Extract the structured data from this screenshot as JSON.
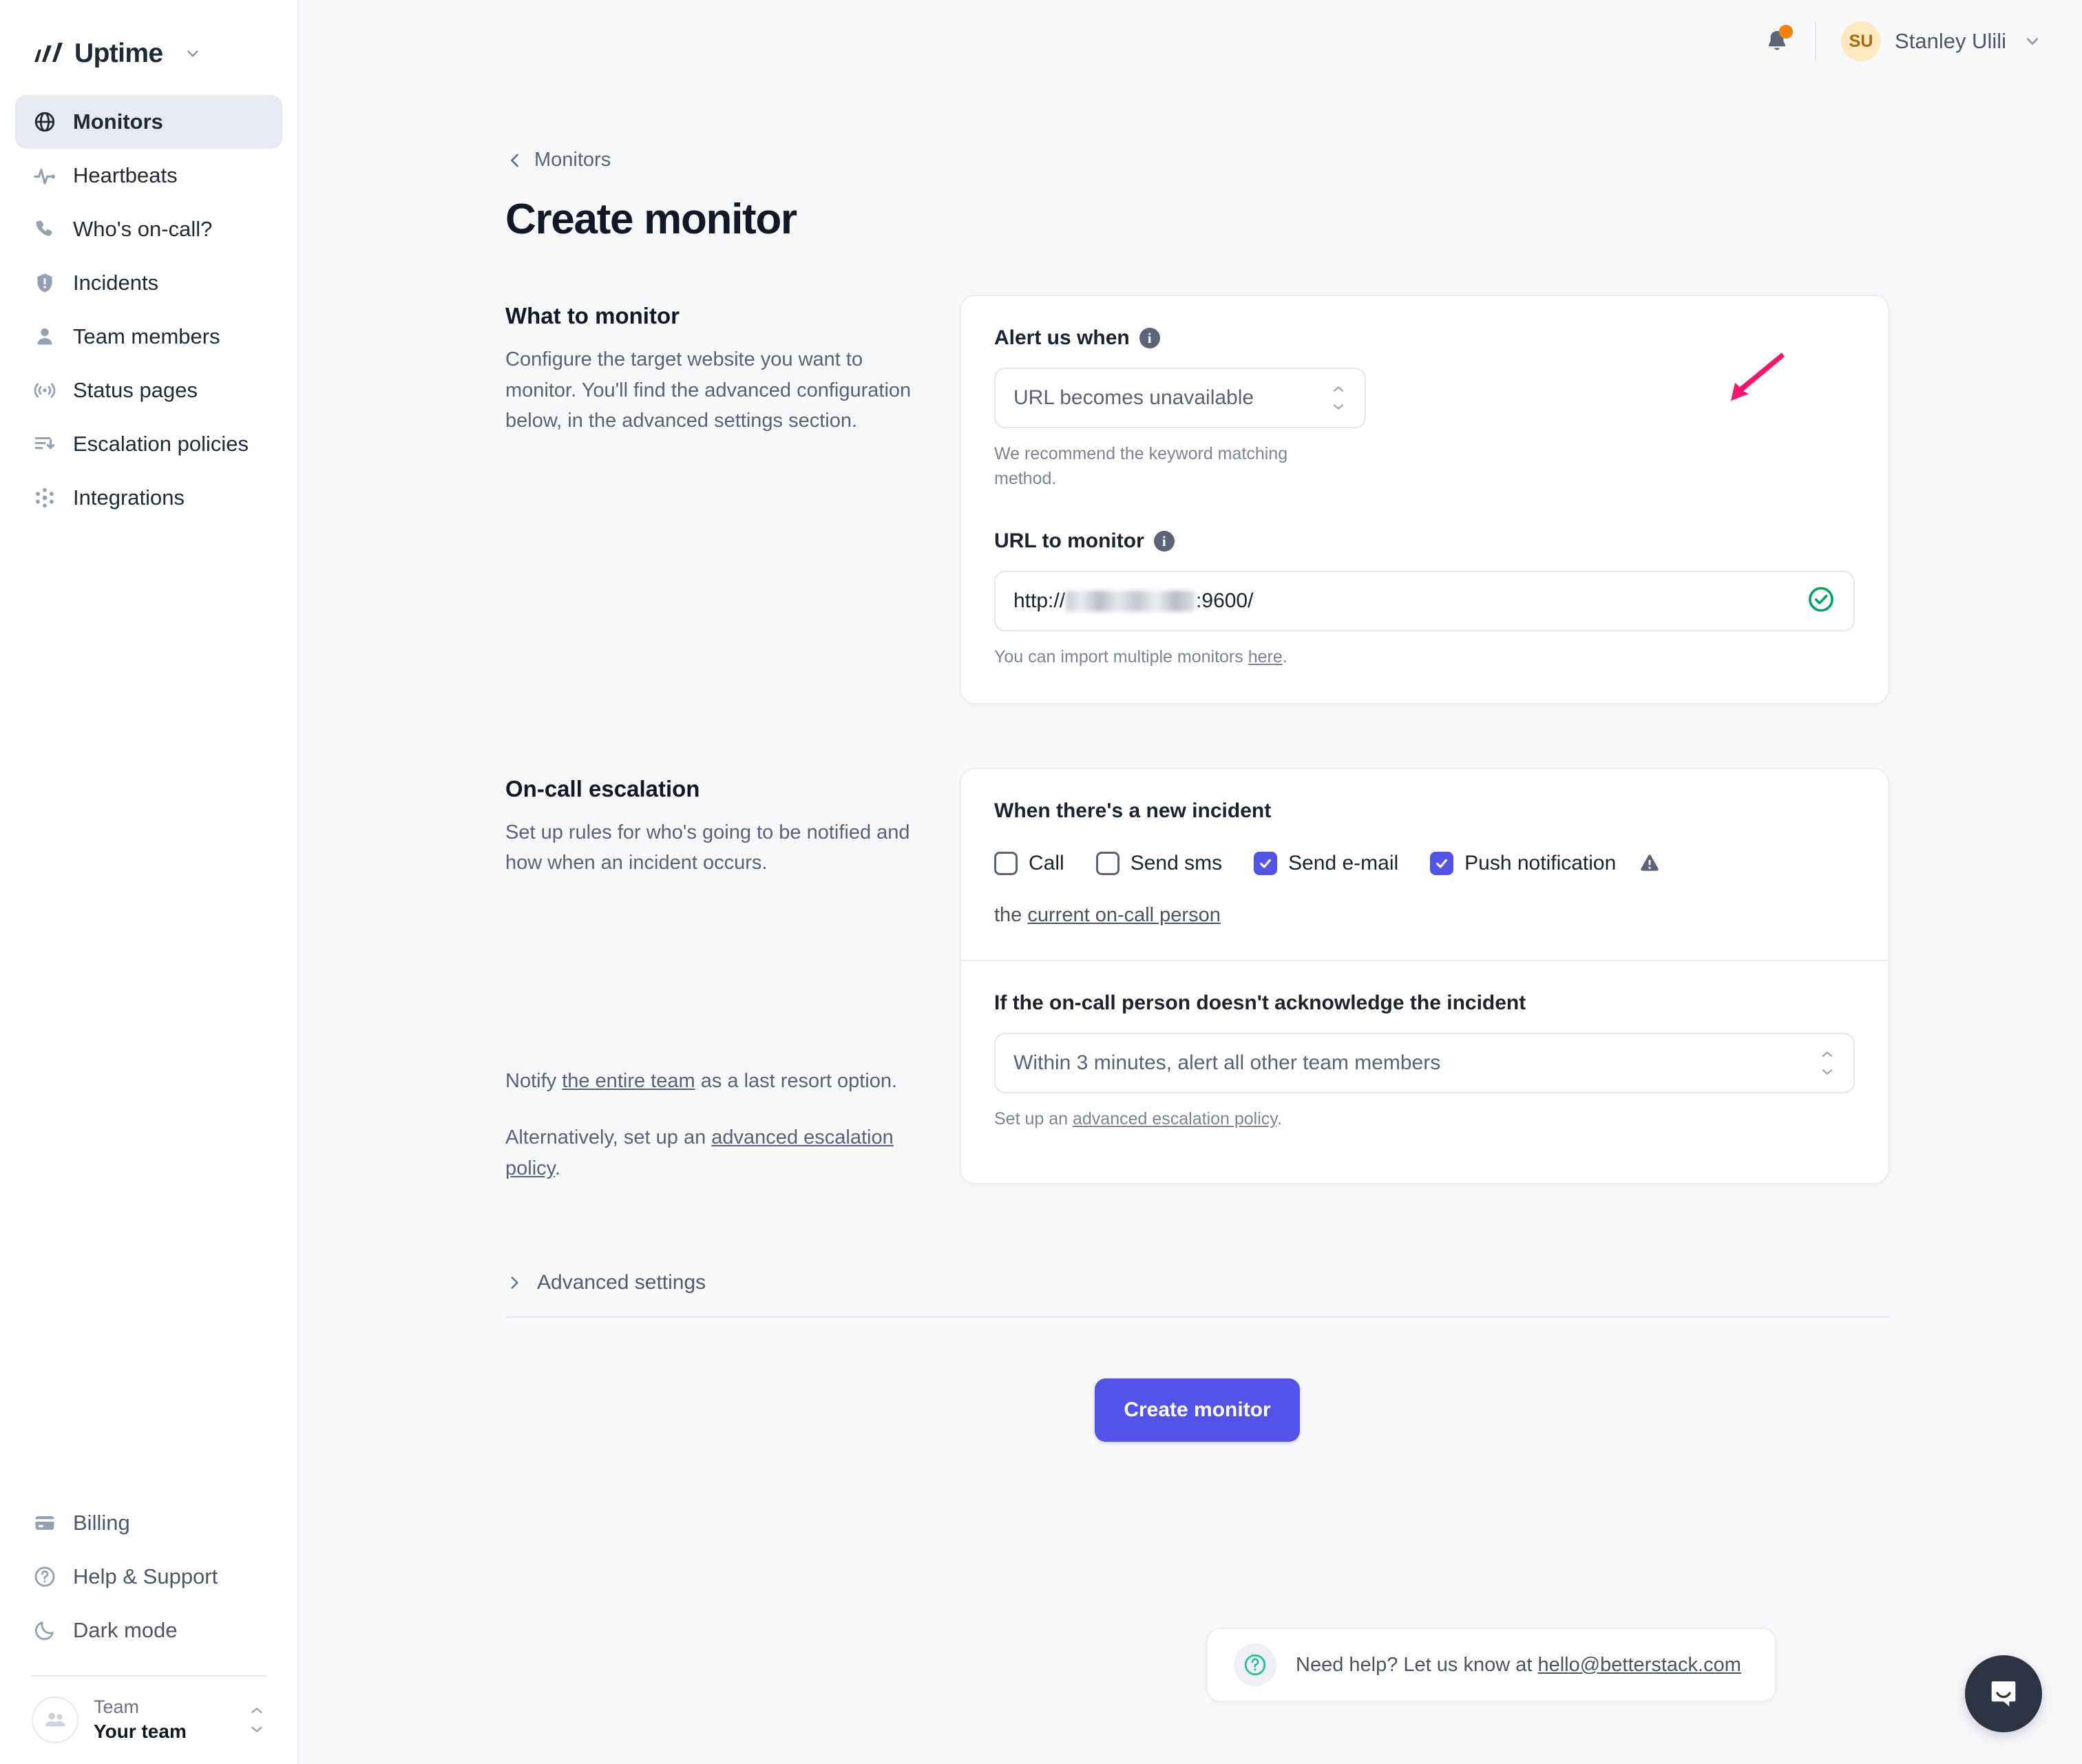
{
  "brand": {
    "name": "Uptime",
    "caret_icon": "chevron-down-icon",
    "logo_icon": "uptime-logo-icon"
  },
  "sidebar": {
    "items": [
      {
        "label": "Monitors",
        "icon": "globe-icon",
        "active": true
      },
      {
        "label": "Heartbeats",
        "icon": "pulse-icon",
        "active": false
      },
      {
        "label": "Who's on-call?",
        "icon": "phone-icon",
        "active": false
      },
      {
        "label": "Incidents",
        "icon": "shield-alert-icon",
        "active": false
      },
      {
        "label": "Team members",
        "icon": "user-icon",
        "active": false
      },
      {
        "label": "Status pages",
        "icon": "broadcast-icon",
        "active": false
      },
      {
        "label": "Escalation policies",
        "icon": "escalation-icon",
        "active": false
      },
      {
        "label": "Integrations",
        "icon": "integrations-icon",
        "active": false
      }
    ],
    "bottom_items": [
      {
        "label": "Billing",
        "icon": "credit-card-icon"
      },
      {
        "label": "Help & Support",
        "icon": "question-circle-icon"
      },
      {
        "label": "Dark mode",
        "icon": "moon-icon"
      }
    ],
    "team": {
      "label": "Team",
      "value": "Your team",
      "avatar_icon": "team-avatar-icon",
      "caret_icon": "chevron-up-down-icon"
    }
  },
  "topbar": {
    "notifications_icon": "bell-icon",
    "has_unread": true,
    "user": {
      "initials": "SU",
      "name": "Stanley Ulili",
      "caret_icon": "chevron-down-icon"
    }
  },
  "breadcrumb": {
    "back_icon": "chevron-left-icon",
    "label": "Monitors"
  },
  "page": {
    "title": "Create monitor"
  },
  "what_to_monitor": {
    "heading": "What to monitor",
    "description": "Configure the target website you want to monitor. You'll find the advanced configuration below, in the advanced settings section.",
    "alert_when": {
      "label": "Alert us when",
      "info_icon": "info-icon",
      "value": "URL becomes unavailable",
      "caret_icon": "chevron-up-down-icon",
      "hint": "We recommend the keyword matching method."
    },
    "url": {
      "label": "URL to monitor",
      "info_icon": "info-icon",
      "value_prefix": "http://",
      "value_redacted": true,
      "value_suffix": ":9600/",
      "valid_icon": "check-circle-icon",
      "hint_prefix": "You can import multiple monitors ",
      "hint_link": "here",
      "hint_suffix": "."
    }
  },
  "on_call": {
    "heading": "On-call escalation",
    "description": "Set up rules for who's going to be notified and how when an incident occurs.",
    "notify_prefix": "Notify ",
    "notify_link": "the entire team",
    "notify_suffix": " as a last resort option.",
    "alt_prefix": "Alternatively, set up an ",
    "alt_link": "advanced escalation policy",
    "alt_suffix": ".",
    "incident": {
      "title": "When there's a new incident",
      "channels": [
        {
          "label": "Call",
          "checked": false,
          "warning": false
        },
        {
          "label": "Send sms",
          "checked": false,
          "warning": false
        },
        {
          "label": "Send e-mail",
          "checked": true,
          "warning": false
        },
        {
          "label": "Push notification",
          "checked": true,
          "warning": true,
          "warning_icon": "warning-triangle-icon"
        }
      ],
      "target_prefix": "the ",
      "target_link": "current on-call person"
    },
    "ack": {
      "title": "If the on-call person doesn't acknowledge the incident",
      "value": "Within 3 minutes, alert all other team members",
      "caret_icon": "chevron-up-down-icon",
      "hint_prefix": "Set up an ",
      "hint_link": "advanced escalation policy",
      "hint_suffix": "."
    }
  },
  "advanced_settings": {
    "label": "Advanced settings",
    "chevron_icon": "chevron-right-icon"
  },
  "submit": {
    "label": "Create monitor"
  },
  "help_bar": {
    "icon": "question-circle-icon",
    "text_prefix": "Need help? Let us know at ",
    "email": "hello@betterstack.com"
  },
  "intercom": {
    "icon": "chat-bubble-icon"
  },
  "colors": {
    "accent": "#5353e8",
    "page_bg": "#f7f8fa",
    "sidebar_bg": "#ffffff",
    "success": "#00a25c",
    "avatar_bg": "#fde8c0",
    "notification_dot": "#f0820f",
    "annotation_arrow": "#f5186a"
  }
}
